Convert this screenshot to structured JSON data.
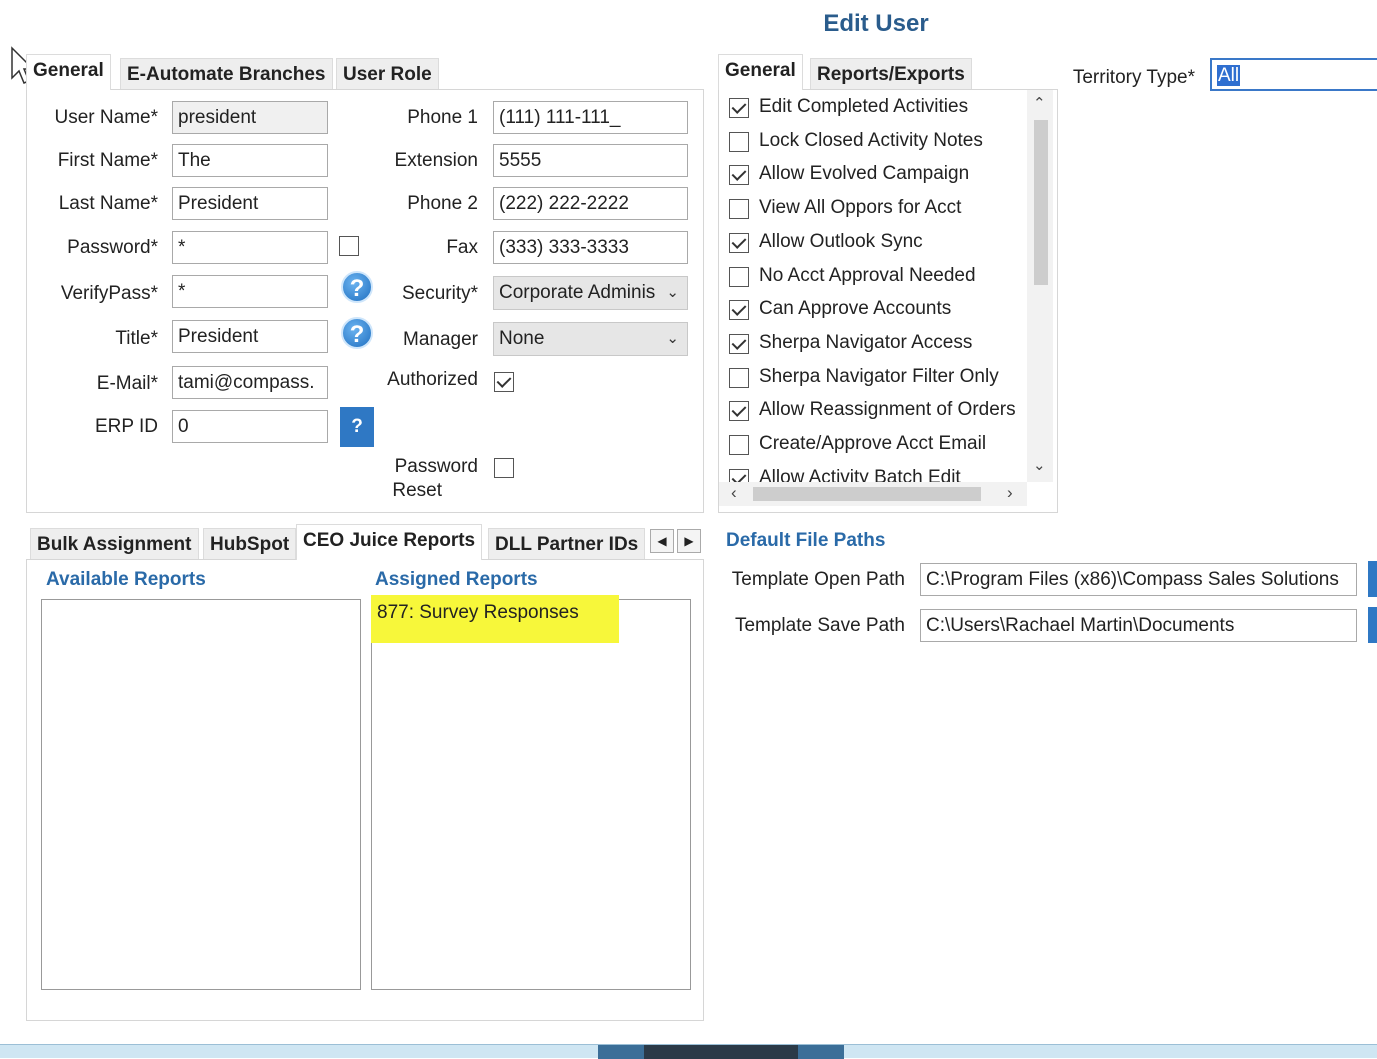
{
  "window": {
    "title": "Edit User"
  },
  "left_tabs": [
    "General",
    "E-Automate Branches",
    "User Role"
  ],
  "general": {
    "user_name": {
      "label": "User Name*",
      "value": "president"
    },
    "first_name": {
      "label": "First Name*",
      "value": "The"
    },
    "last_name": {
      "label": "Last Name*",
      "value": "President"
    },
    "password": {
      "label": "Password*",
      "value": "*"
    },
    "verify_pass": {
      "label": "VerifyPass*",
      "value": "*"
    },
    "title": {
      "label": "Title*",
      "value": "President"
    },
    "email": {
      "label": "E-Mail*",
      "value": "tami@compass."
    },
    "erp_id": {
      "label": "ERP ID",
      "value": "0"
    },
    "phone1": {
      "label": "Phone 1",
      "value": "(111) 111-111_"
    },
    "extension": {
      "label": "Extension",
      "value": "5555"
    },
    "phone2": {
      "label": "Phone 2",
      "value": "(222) 222-2222"
    },
    "fax": {
      "label": "Fax",
      "value": "(333) 333-3333"
    },
    "security": {
      "label": "Security*",
      "value": "Corporate Adminis"
    },
    "manager": {
      "label": "Manager",
      "value": "None"
    },
    "authorized": {
      "label": "Authorized",
      "checked": true
    },
    "password_reset": {
      "label_line1": "Password",
      "label_line2": "Reset",
      "checked": false
    },
    "erp_help_label": "?"
  },
  "right_tabs": [
    "General",
    "Reports/Exports"
  ],
  "territory": {
    "label": "Territory Type*",
    "value": "All"
  },
  "permissions": [
    {
      "label": "Edit Completed Activities",
      "checked": true
    },
    {
      "label": "Lock Closed Activity Notes",
      "checked": false
    },
    {
      "label": "Allow Evolved Campaign",
      "checked": true
    },
    {
      "label": "View All Oppors for Acct",
      "checked": false
    },
    {
      "label": "Allow Outlook Sync",
      "checked": true
    },
    {
      "label": "No Acct Approval Needed",
      "checked": false
    },
    {
      "label": "Can Approve Accounts",
      "checked": true
    },
    {
      "label": "Sherpa Navigator Access",
      "checked": true
    },
    {
      "label": "Sherpa Navigator Filter Only",
      "checked": false
    },
    {
      "label": "Allow Reassignment of Orders",
      "checked": true
    },
    {
      "label": "Create/Approve Acct Email",
      "checked": false
    },
    {
      "label": "Allow Activity Batch Edit",
      "checked": true
    }
  ],
  "bottom_tabs": [
    "Bulk Assignment",
    "HubSpot",
    "CEO Juice Reports",
    "DLL Partner IDs"
  ],
  "reports": {
    "available_label": "Available Reports",
    "assigned_label": "Assigned Reports",
    "available": [],
    "assigned": [
      "877: Survey Responses"
    ],
    "highlight_color": "#f7f73a"
  },
  "file_paths": {
    "section_label": "Default File Paths",
    "open": {
      "label": "Template Open Path",
      "value": "C:\\Program Files (x86)\\Compass Sales Solutions"
    },
    "save": {
      "label": "Template Save Path",
      "value": "C:\\Users\\Rachael Martin\\Documents"
    }
  },
  "colors": {
    "accent": "#2a5c8c",
    "section": "#2a6aa8",
    "help_button": "#2f78c4"
  }
}
